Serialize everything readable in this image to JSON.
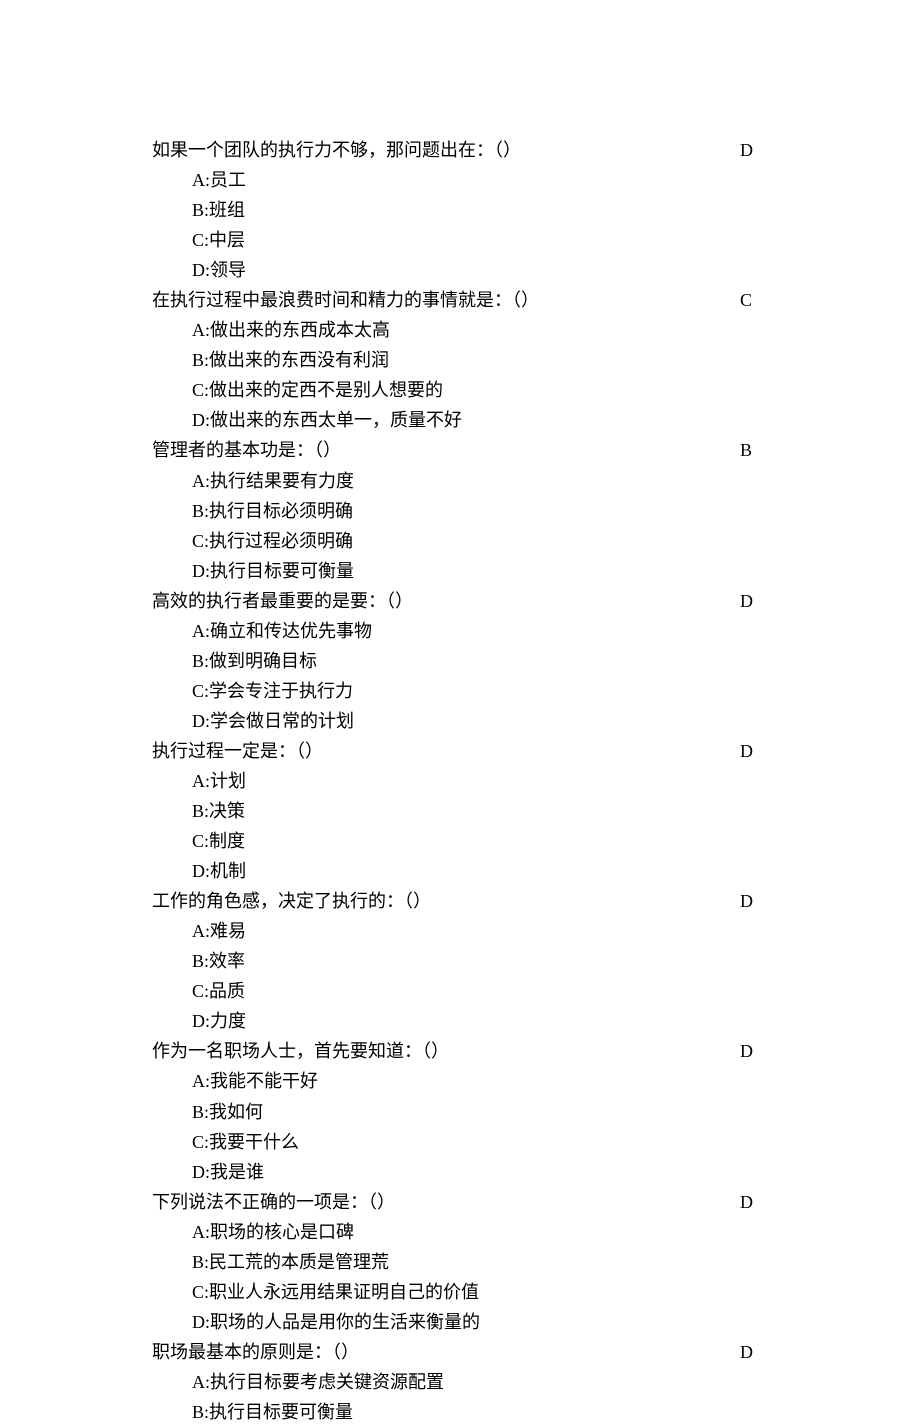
{
  "questions": [
    {
      "stem": "如果一个团队的执行力不够，那问题出在：（）",
      "answer": "D",
      "options": [
        "A:员工",
        "B:班组",
        "C:中层",
        "D:领导"
      ]
    },
    {
      "stem": "在执行过程中最浪费时间和精力的事情就是：（）",
      "answer": "C",
      "options": [
        "A:做出来的东西成本太高",
        "B:做出来的东西没有利润",
        "C:做出来的定西不是别人想要的",
        "D:做出来的东西太单一，质量不好"
      ]
    },
    {
      "stem": "管理者的基本功是：（）",
      "answer": "B",
      "options": [
        "A:执行结果要有力度",
        "B:执行目标必须明确",
        "C:执行过程必须明确",
        "D:执行目标要可衡量"
      ]
    },
    {
      "stem": "高效的执行者最重要的是要：（）",
      "answer": "D",
      "options": [
        "A:确立和传达优先事物",
        "B:做到明确目标",
        "C:学会专注于执行力",
        "D:学会做日常的计划"
      ]
    },
    {
      "stem": "执行过程一定是：（）",
      "answer": "D",
      "options": [
        "A:计划",
        "B:决策",
        "C:制度",
        "D:机制"
      ]
    },
    {
      "stem": "工作的角色感，决定了执行的：（）",
      "answer": "D",
      "options": [
        "A:难易",
        "B:效率",
        "C:品质",
        "D:力度"
      ]
    },
    {
      "stem": "作为一名职场人士，首先要知道：（）",
      "answer": "D",
      "options": [
        "A:我能不能干好",
        "B:我如何",
        "C:我要干什么",
        "D:我是谁"
      ]
    },
    {
      "stem": "下列说法不正确的一项是：（）",
      "answer": "D",
      "options": [
        "A:职场的核心是口碑",
        "B:民工荒的本质是管理荒",
        "C:职业人永远用结果证明自己的价值",
        "D:职场的人品是用你的生活来衡量的"
      ]
    },
    {
      "stem": "职场最基本的原则是：（）",
      "answer": "D",
      "options": [
        "A:执行目标要考虑关键资源配置",
        "B:执行目标要可衡量"
      ]
    }
  ]
}
